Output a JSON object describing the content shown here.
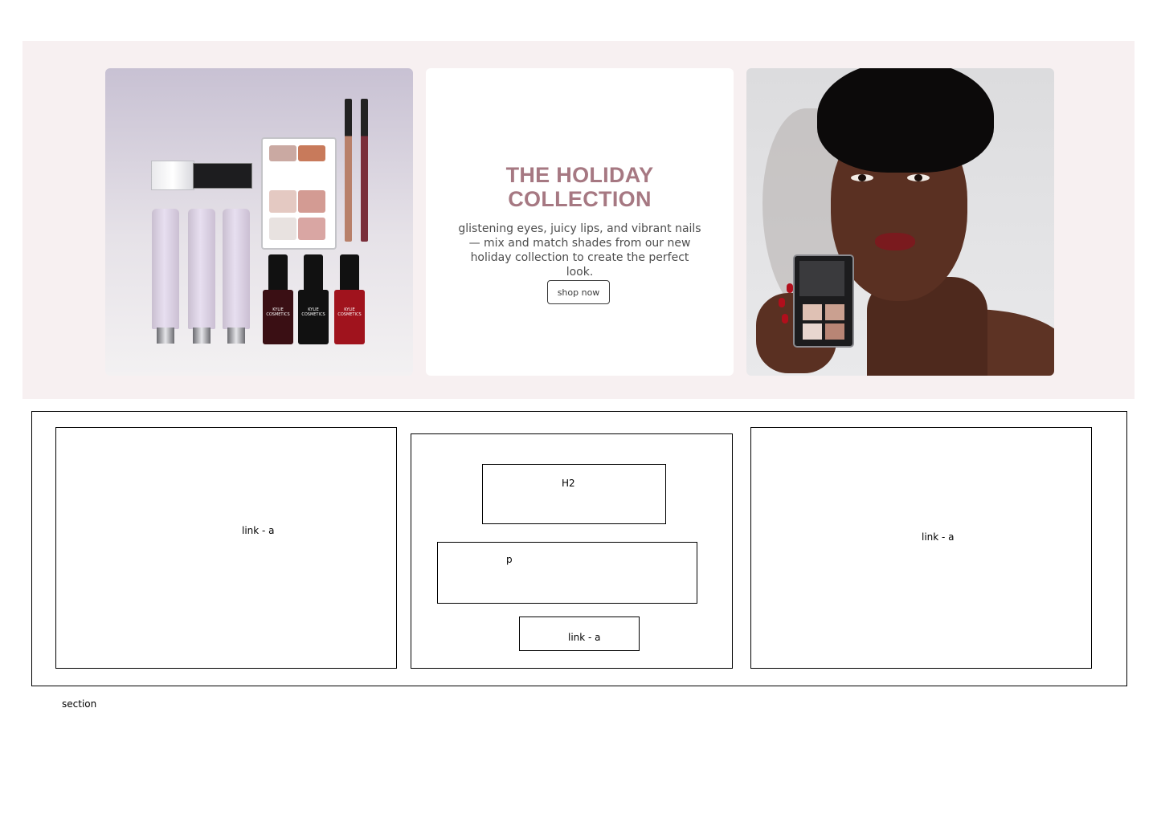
{
  "banner": {
    "left_image": {
      "nail_polish_labels": [
        "KYLIE COSMETICS",
        "KYLIE COSMETICS",
        "KYLIE COSMETICS"
      ]
    },
    "center": {
      "title_line1": "THE HOLIDAY",
      "title_line2": "COLLECTION",
      "description": "glistening eyes, juicy lips, and vibrant nails — mix and match shades from our new holiday collection to create the perfect look.",
      "button_label": "shop now",
      "title_color": "#a67882"
    },
    "background_color": "#f7f0f1"
  },
  "wireframe": {
    "left_label": "link - a",
    "h2_label": "H2",
    "p_label": "p",
    "button_link_label": "link - a",
    "right_label": "link - a",
    "section_label": "section"
  }
}
